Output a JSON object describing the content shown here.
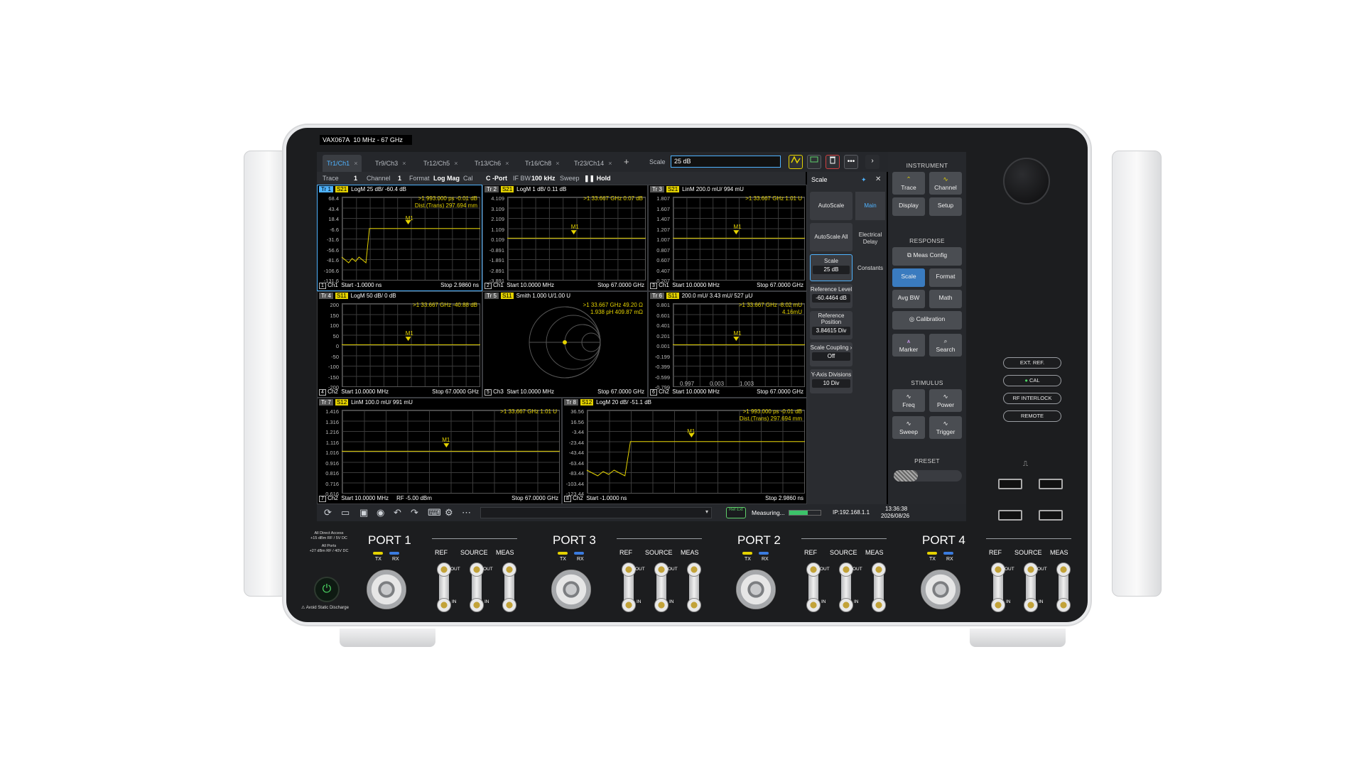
{
  "device": {
    "model": "VAX067A",
    "range": "10 MHz - 67 GHz"
  },
  "tabs": [
    {
      "label": "Tr1/Ch1",
      "active": true
    },
    {
      "label": "Tr9/Ch3"
    },
    {
      "label": "Tr12/Ch5"
    },
    {
      "label": "Tr13/Ch6"
    },
    {
      "label": "Tr16/Ch8"
    },
    {
      "label": "Tr23/Ch14"
    }
  ],
  "toolbar": {
    "add": "+",
    "scale_label": "Scale",
    "scale_value": "25 dB",
    "more": "•••",
    "next": "›"
  },
  "infobar": {
    "trace_label": "Trace",
    "trace_val": "1",
    "channel_label": "Channel",
    "channel_val": "1",
    "format_label": "Format",
    "format_val": "Log Mag",
    "cal_label": "Cal",
    "cal_val": "C -Port",
    "ifbw_label": "IF BW",
    "ifbw_val": "100 kHz",
    "sweep_label": "Sweep",
    "sweep_val": "Hold"
  },
  "panes": [
    {
      "tr": "Tr 1",
      "sp": "S21",
      "fmt": "LogM 25 dB/ -60.4 dB",
      "m1": ">1   993.000 ps   -0.01 dB",
      "m2": "Dist.(Trans)   297.694 mm",
      "ticks": [
        "68.4",
        "43.4",
        "18.4",
        "-6.6",
        "-31.6",
        "-56.6",
        "-81.6",
        "-106.6",
        "-131.6"
      ],
      "n": "1",
      "ch": "Ch1",
      "start": "Start  -1.0000 ns",
      "stop": "Stop  2.9860 ns"
    },
    {
      "tr": "Tr 2",
      "sp": "S21",
      "fmt": "LogM 1 dB/ 0.11 dB",
      "m1": ">1   33.667 GHz   0.07 dB",
      "m2": "",
      "ticks": [
        "4.109",
        "3.109",
        "2.109",
        "1.109",
        "0.109",
        "-0.891",
        "-1.891",
        "-2.891",
        "-3.891"
      ],
      "n": "2",
      "ch": "Ch1",
      "start": "Start  10.0000 MHz",
      "stop": "Stop  67.0000 GHz"
    },
    {
      "tr": "Tr 3",
      "sp": "S21",
      "fmt": "LinM 200.0 mU/ 994 mU",
      "m1": ">1   33.667 GHz   1.01 U",
      "m2": "",
      "ticks": [
        "1.807",
        "1.607",
        "1.407",
        "1.207",
        "1.007",
        "0.807",
        "0.607",
        "0.407",
        "0.207"
      ],
      "n": "3",
      "ch": "Ch1",
      "start": "Start  10.0000 MHz",
      "stop": "Stop  67.0000 GHz"
    },
    {
      "tr": "Tr 4",
      "sp": "S11",
      "fmt": "LogM 50 dB/ 0 dB",
      "m1": ">1   33.667 GHz   -40.88 dB",
      "m2": "",
      "ticks": [
        "200",
        "150",
        "100",
        "50",
        "0",
        "-50",
        "-100",
        "-150",
        "-200"
      ],
      "n": "4",
      "ch": "Ch2",
      "start": "Start  10.0000 MHz",
      "stop": "Stop  67.0000 GHz"
    },
    {
      "tr": "Tr 5",
      "sp": "S11",
      "fmt": "Smith 1.000 U/1.00 U",
      "m1": ">1   33.667 GHz   49.20 Ω",
      "m2": "1.938 pH   409.87 mΩ",
      "ticks": [],
      "n": "5",
      "ch": "Ch3",
      "start": "Start  10.0000 MHz",
      "stop": "Stop  67.0000 GHz"
    },
    {
      "tr": "Tr 6",
      "sp": "S11",
      "fmt": "200.0 mU/ 3.43 mU/ 527 μU",
      "m1": ">1   33.667 GHz   -8.02 mU",
      "m2": "4.16mU",
      "ticks": [
        "0.801",
        "0.601",
        "0.401",
        "0.201",
        "0.001",
        "-0.199",
        "-0.399",
        "-0.599",
        "-0.799"
      ],
      "n": "6",
      "ch": "Ch2",
      "start": "Start  10.0000 MHz",
      "stop": "Stop  67.0000 GHz",
      "polar": [
        "0.997",
        "0.003",
        "1.003"
      ]
    },
    {
      "tr": "Tr 7",
      "sp": "S12",
      "fmt": "LinM 100.0 mU/ 991 mU",
      "m1": ">1   33.667 GHz   1.01 U",
      "m2": "",
      "ticks": [
        "1.416",
        "1.316",
        "1.216",
        "1.116",
        "1.016",
        "0.916",
        "0.816",
        "0.716",
        "0.616"
      ],
      "n": "7",
      "ch": "Ch2",
      "start": "Start  10.0000 MHz",
      "stop": "Stop  67.0000 GHz",
      "rf": "RF  -5.00 dBm"
    },
    {
      "tr": "Tr 8",
      "sp": "S12",
      "fmt": "LogM 20 dB/ -51.1 dB",
      "m1": ">1   993.000 ps   -0.01 dB",
      "m2": "Dist.(Trans)   297.694 mm",
      "ticks": [
        "36.56",
        "16.56",
        "-3.44",
        "-23.44",
        "-43.44",
        "-63.44",
        "-83.44",
        "-103.44",
        "-123.44"
      ],
      "n": "8",
      "ch": "Ch2",
      "start": "Start  -1.0000 ns",
      "stop": "Stop  2.9860 ns"
    }
  ],
  "marker_label": "M1",
  "scale_panel": {
    "title": "Scale",
    "autoscale": "AutoScale",
    "autoscale_all": "AutoScale All",
    "scale": "Scale",
    "scale_val": "25 dB",
    "ref_level": "Reference Level",
    "ref_level_val": "-60.4464 dB",
    "ref_pos": "Reference Position",
    "ref_pos_val": "3.84615 Div",
    "coupling": "Scale Coupling",
    "coupling_val": "Off",
    "ydiv": "Y-Axis Divisions",
    "ydiv_val": "10 Div",
    "tabs": [
      "Main",
      "Electrical Delay",
      "Constants"
    ]
  },
  "right_menu": {
    "instrument": "INSTRUMENT",
    "trace": "Trace",
    "channel": "Channel",
    "display": "Display",
    "setup": "Setup",
    "response": "RESPONSE",
    "meas_config": "Meas Config",
    "scale": "Scale",
    "format": "Format",
    "avg_bw": "Avg BW",
    "math": "Math",
    "calibration": "Calibration",
    "marker": "Marker",
    "search": "Search",
    "stimulus": "STIMULUS",
    "freq": "Freq",
    "power": "Power",
    "sweep": "Sweep",
    "trigger": "Trigger",
    "preset": "PRESET"
  },
  "status": {
    "measuring": "Measuring...",
    "ip": "IP:192.168.1.1",
    "time": "13:36:38",
    "date": "2026/08/26",
    "ref": "Ref Ext"
  },
  "front_buttons": [
    "EXT. REF.",
    "CAL",
    "RF INTERLOCK",
    "REMOTE"
  ],
  "ports": [
    {
      "name": "PORT 1"
    },
    {
      "name": "PORT 3"
    },
    {
      "name": "PORT 2"
    },
    {
      "name": "PORT 4"
    }
  ],
  "port_labels": {
    "tx": "TX",
    "rx": "RX",
    "ref": "REF",
    "source": "SOURCE",
    "meas": "MEAS",
    "out": "OUT",
    "in": "IN"
  },
  "warnings": {
    "w1": "All Direct Access",
    "w2": "+15 dBm RF / 5V DC",
    "w3": "All Ports",
    "w4": "+27 dBm RF / 40V DC",
    "static": "Avoid Static Discharge"
  },
  "colors": {
    "trace": "#e4d200",
    "accent": "#4fb3ff",
    "panel": "#1c1d1f"
  }
}
